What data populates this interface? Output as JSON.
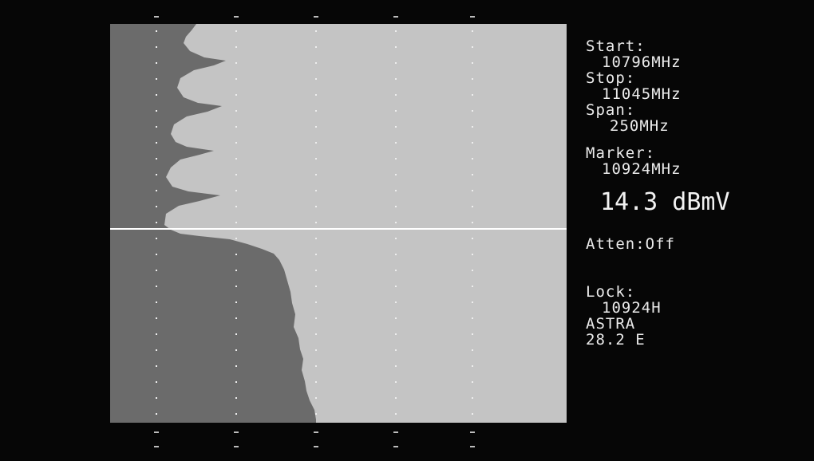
{
  "analyzer": {
    "start_label": "Start:",
    "start_value": "10796MHz",
    "stop_label": "Stop:",
    "stop_value": "11045MHz",
    "span_label": "Span:",
    "span_value": "250MHz",
    "marker_label": "Marker:",
    "marker_value": "10924MHz",
    "level_value": "14.3 dBmV",
    "atten_label": "Atten:Off",
    "lock_label": "Lock:",
    "lock_freq": "10924H",
    "lock_satellite": "ASTRA",
    "lock_position": "28.2 E"
  },
  "colors": {
    "background": "#060606",
    "plot_fill_low": "#6a6a6a",
    "plot_fill_high": "#c4c4c4",
    "text": "#ebebeb",
    "marker_line": "#ffffff"
  },
  "marker": {
    "level_fraction_from_top": 0.514
  }
}
